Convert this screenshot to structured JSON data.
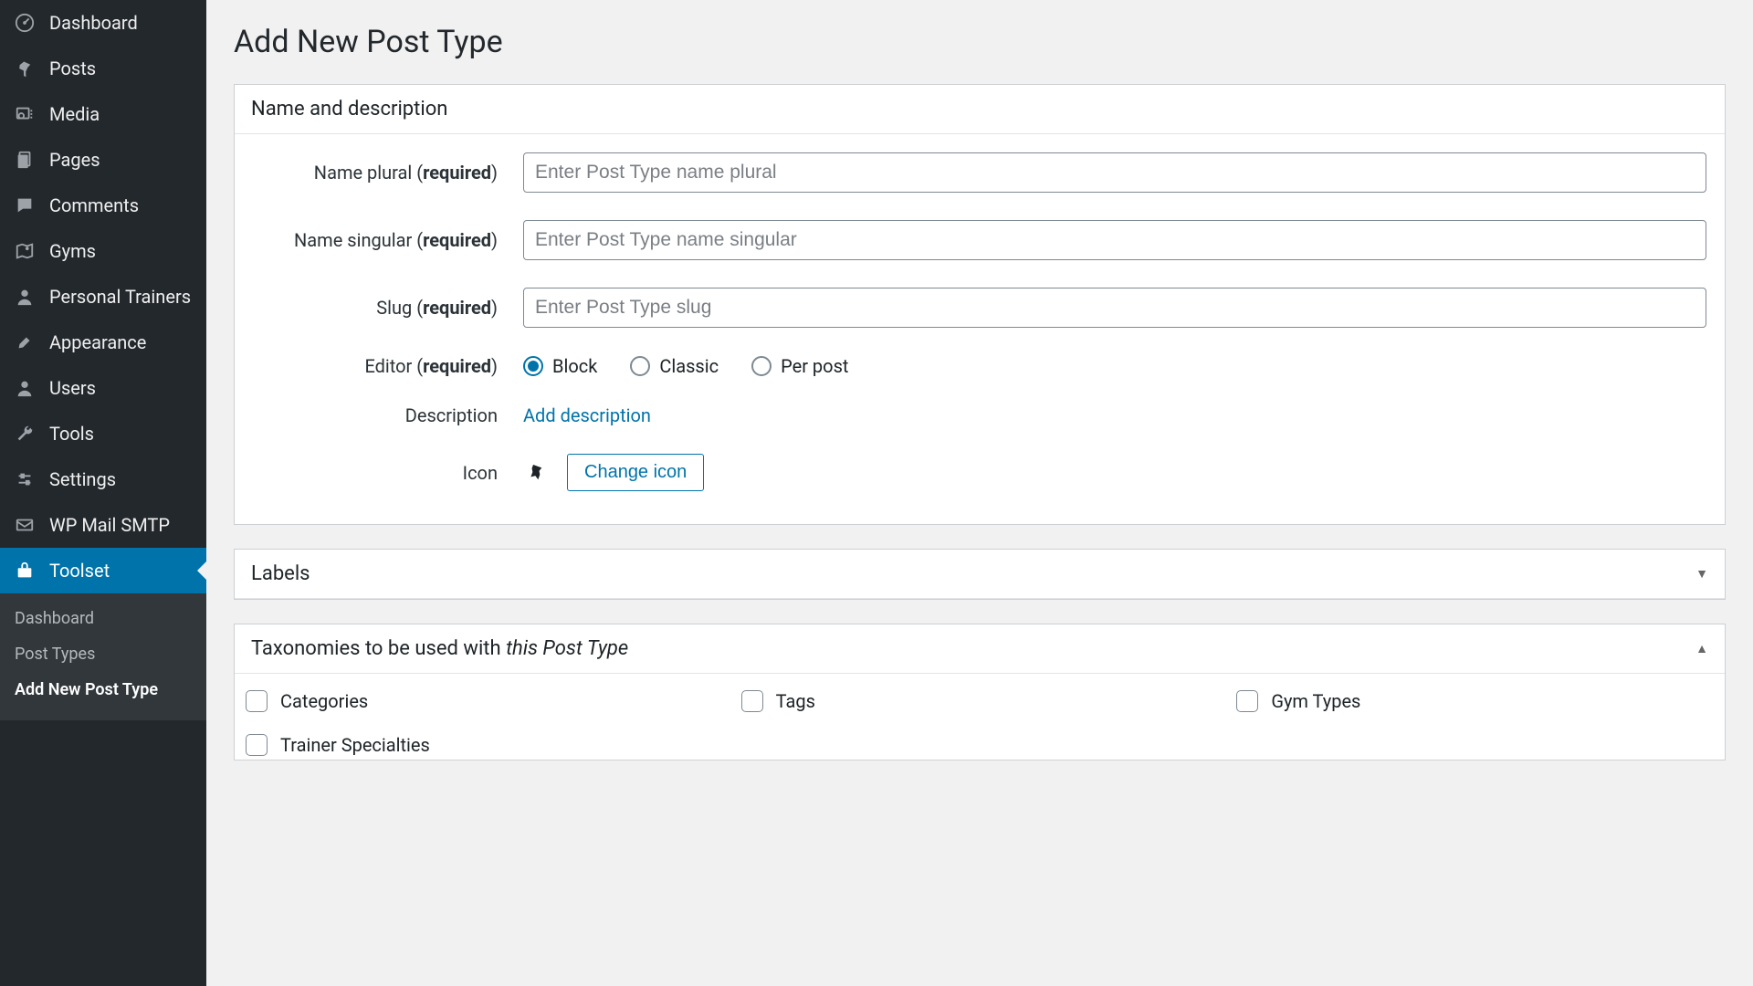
{
  "sidebar": {
    "items": [
      {
        "label": "Dashboard",
        "icon": "dashboard"
      },
      {
        "label": "Posts",
        "icon": "pin"
      },
      {
        "label": "Media",
        "icon": "media"
      },
      {
        "label": "Pages",
        "icon": "pages"
      },
      {
        "label": "Comments",
        "icon": "comment"
      },
      {
        "label": "Gyms",
        "icon": "map"
      },
      {
        "label": "Personal Trainers",
        "icon": "user"
      },
      {
        "label": "Appearance",
        "icon": "brush"
      },
      {
        "label": "Users",
        "icon": "user"
      },
      {
        "label": "Tools",
        "icon": "wrench"
      },
      {
        "label": "Settings",
        "icon": "sliders"
      },
      {
        "label": "WP Mail SMTP",
        "icon": "mail"
      },
      {
        "label": "Toolset",
        "icon": "toolset",
        "active": true
      }
    ],
    "sub": [
      {
        "label": "Dashboard"
      },
      {
        "label": "Post Types"
      },
      {
        "label": "Add New Post Type",
        "current": true
      }
    ]
  },
  "page": {
    "title": "Add New Post Type"
  },
  "panels": {
    "name_desc": {
      "heading": "Name and description",
      "fields": {
        "name_plural": {
          "label": "Name plural",
          "required_text": "required",
          "placeholder": "Enter Post Type name plural"
        },
        "name_singular": {
          "label": "Name singular",
          "required_text": "required",
          "placeholder": "Enter Post Type name singular"
        },
        "slug": {
          "label": "Slug",
          "required_text": "required",
          "placeholder": "Enter Post Type slug"
        },
        "editor": {
          "label": "Editor",
          "required_text": "required",
          "options": [
            "Block",
            "Classic",
            "Per post"
          ],
          "selected": "Block"
        },
        "description": {
          "label": "Description",
          "action": "Add description"
        },
        "icon": {
          "label": "Icon",
          "button": "Change icon"
        }
      }
    },
    "labels": {
      "heading": "Labels"
    },
    "taxonomies": {
      "heading_pre": "Taxonomies to be used with ",
      "heading_italic": "this Post Type",
      "items": [
        "Categories",
        "Tags",
        "Gym Types",
        "Trainer Specialties"
      ]
    }
  }
}
